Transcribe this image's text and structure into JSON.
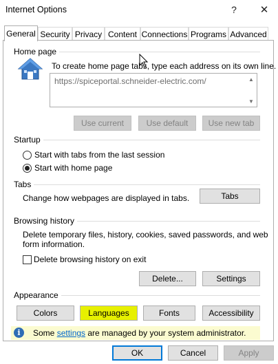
{
  "window": {
    "title": "Internet Options",
    "help_glyph": "?",
    "close_glyph": "✕"
  },
  "tabs": [
    {
      "label": "General",
      "active": true
    },
    {
      "label": "Security"
    },
    {
      "label": "Privacy"
    },
    {
      "label": "Content"
    },
    {
      "label": "Connections"
    },
    {
      "label": "Programs"
    },
    {
      "label": "Advanced"
    }
  ],
  "home_page": {
    "label": "Home page",
    "description": "To create home page tabs, type each address on its own line.",
    "url": "https://spiceportal.schneider-electric.com/",
    "buttons": {
      "use_current": "Use current",
      "use_default": "Use default",
      "use_new_tab": "Use new tab"
    }
  },
  "startup": {
    "label": "Startup",
    "options": [
      {
        "label": "Start with tabs from the last session",
        "selected": false
      },
      {
        "label": "Start with home page",
        "selected": true
      }
    ]
  },
  "tabs_group": {
    "label": "Tabs",
    "description": "Change how webpages are displayed in tabs.",
    "button": "Tabs"
  },
  "browsing_history": {
    "label": "Browsing history",
    "description_line1": "Delete temporary files, history, cookies, saved passwords, and web",
    "description_line2": "form information.",
    "checkbox_label": "Delete browsing history on exit",
    "checkbox_checked": false,
    "delete_button": "Delete...",
    "settings_button": "Settings"
  },
  "appearance": {
    "label": "Appearance",
    "buttons": {
      "colors": "Colors",
      "languages": "Languages",
      "fonts": "Fonts",
      "accessibility": "Accessibility"
    },
    "highlight_color": "#e7f000"
  },
  "info": {
    "prefix": "Some ",
    "link": "settings",
    "suffix": " are managed by your system administrator.",
    "icon_glyph": "i"
  },
  "footer": {
    "ok": "OK",
    "cancel": "Cancel",
    "apply": "Apply"
  }
}
